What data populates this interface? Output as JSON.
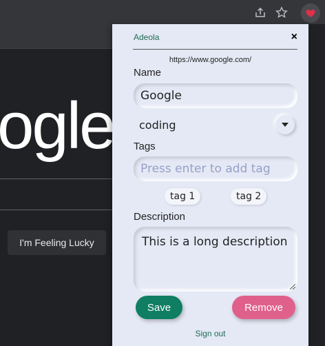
{
  "browser": {
    "icons": [
      "share-icon",
      "star-icon",
      "extension-heart-icon"
    ],
    "accent": "#e0304a"
  },
  "page": {
    "logo_text": "ogle",
    "lucky_button": "I'm Feeling Lucky"
  },
  "popup": {
    "user": "Adeola",
    "close_label": "×",
    "url": "https://www.google.com/",
    "name_label": "Name",
    "name_value": "Google",
    "category_value": "coding",
    "tags_label": "Tags",
    "tags_placeholder": "Press enter to add tag",
    "tags": [
      {
        "label": "tag 1"
      },
      {
        "label": "tag 2"
      }
    ],
    "description_label": "Description",
    "description_value": "This is a long description",
    "save_label": "Save",
    "remove_label": "Remove",
    "signout_label": "Sign out",
    "colors": {
      "background": "#e5e9f5",
      "save": "#0f7e63",
      "remove": "#e0608c",
      "link": "#1f6b52"
    }
  }
}
